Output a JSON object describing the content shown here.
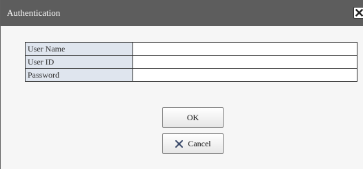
{
  "dialog": {
    "title": "Authentication",
    "close_icon": "close-icon"
  },
  "form": {
    "fields": [
      {
        "label": "User Name",
        "value": ""
      },
      {
        "label": "User ID",
        "value": ""
      },
      {
        "label": "Password",
        "value": ""
      }
    ]
  },
  "buttons": {
    "ok_label": "OK",
    "cancel_label": "Cancel",
    "cancel_icon": "x-icon"
  },
  "colors": {
    "titlebar": "#5d5d5d",
    "label_cell": "#dfe5ee",
    "background": "#f6f6f6"
  }
}
